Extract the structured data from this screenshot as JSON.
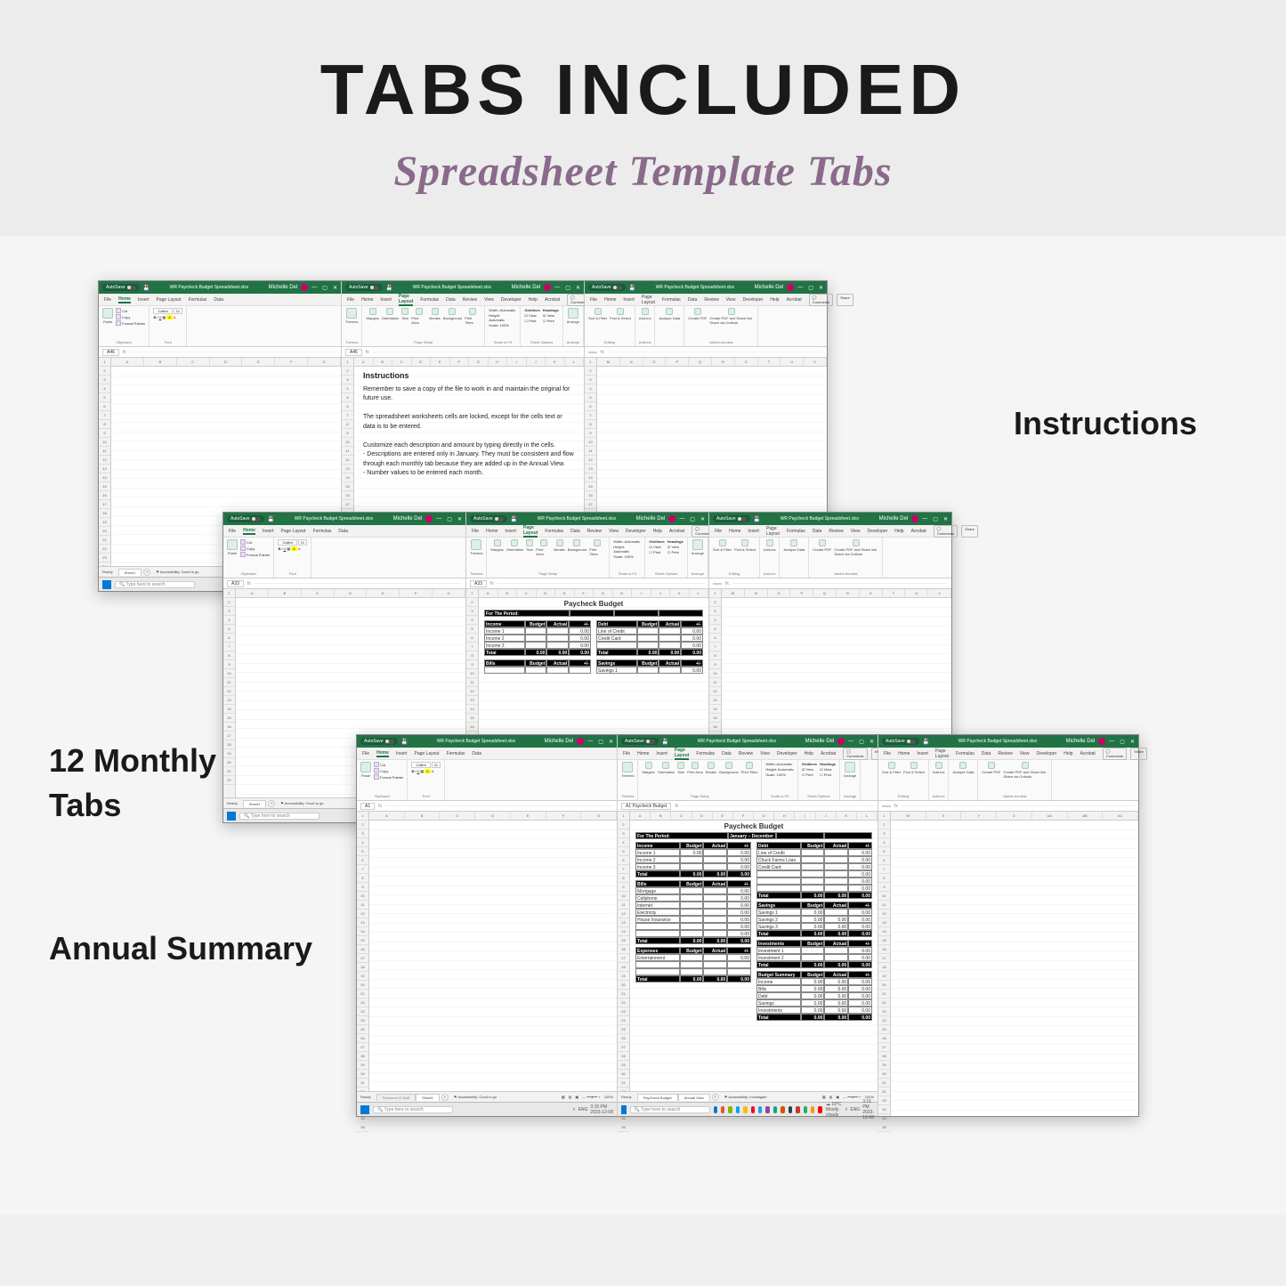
{
  "title": "TABS INCLUDED",
  "subtitle": "Spreadsheet Template Tabs",
  "labels": {
    "instructions": "Instructions",
    "monthly": "12 Monthly Tabs",
    "annual": "Annual Summary"
  },
  "excel": {
    "autosave": "AutoSave",
    "filename": "WR Paycheck Budget Spreadsheet.xlsx",
    "user": "Michelle Del",
    "ribbon_tabs": [
      "File",
      "Home",
      "Insert",
      "Page Layout",
      "Formulas",
      "Data",
      "Review",
      "View",
      "Developer",
      "Help",
      "Acrobat"
    ],
    "ribbon_tabs_simple": [
      "File",
      "Home",
      "Insert",
      "Page Layout",
      "Formulas",
      "Data"
    ],
    "comments": "Comments",
    "share": "Share",
    "ribbon_home": {
      "paste": "Paste",
      "cut": "Cut",
      "copy": "Copy",
      "format_painter": "Format Painter",
      "clipboard": "Clipboard",
      "font_name": "Calibri",
      "font_size": "11",
      "font": "Font"
    },
    "ribbon_pagelayout": {
      "themes": "Themes",
      "margins": "Margins",
      "orientation": "Orientation",
      "size": "Size",
      "print_area": "Print Area",
      "breaks": "Breaks",
      "background": "Background",
      "print_titles": "Print Titles",
      "page_setup": "Page Setup",
      "width": "Width:",
      "height": "Height:",
      "scale": "Scale:",
      "automatic": "Automatic",
      "hundred": "100%",
      "scale_to_fit": "Scale to Fit",
      "gridlines": "Gridlines",
      "headings": "Headings",
      "view": "View",
      "print": "Print",
      "sheet_options": "Sheet Options",
      "arrange": "Arrange"
    },
    "ribbon_right": {
      "sort_filter": "Sort & Filter",
      "find_select": "Find & Select",
      "editing": "Editing",
      "addins": "Add-ins",
      "analyze": "Analyze Data",
      "create_pdf": "Create PDF",
      "create_share": "Create PDF and Share link Share via Outlook",
      "adobe": "Adobe Acrobat"
    },
    "cols": [
      "A",
      "B",
      "C",
      "D",
      "E",
      "F",
      "G",
      "H",
      "I",
      "J",
      "K",
      "L",
      "M",
      "N",
      "O",
      "P",
      "Q",
      "R",
      "S",
      "T",
      "U",
      "V",
      "W",
      "X",
      "Y",
      "Z",
      "AA",
      "AB",
      "AC"
    ],
    "namebox1": "A46",
    "namebox2": "A33",
    "namebox3": "A1",
    "fx": "fx",
    "ready": "Ready",
    "accessibility_ok": "Accessibility: Good to go",
    "accessibility_inv": "Accessibility: Investigate",
    "sheet1": "Sheet1",
    "tab_paycheck": "PayCheck Budget",
    "tab_annual": "Annual View",
    "tab_dim": "Password & Stuff",
    "search_placeholder": "Type here to search",
    "weather": "19°C  Mostly cloudy",
    "lang": "ENG",
    "time": "3:15 PM",
    "date": "2023-12-08"
  },
  "instructions_doc": {
    "heading": "Instructions",
    "l1": "Remember to save a copy of the file to work in and maintain the original for future use.",
    "l2": "The spreadsheet worksheets cells are locked, except for the cells text or data is to be entered.",
    "l3a": "Customize each description and amount by typing directly in the cells.",
    "l3b": "- Descriptions are entered only in January. They must be consistent and flow",
    "l3c": "  through each monthly tab because they are added up in the Annual View.",
    "l3d": "- Number values to be entered each month."
  },
  "budget": {
    "title": "Paycheck Budget",
    "period_label": "For The Period:",
    "period_value": "January – December",
    "income": {
      "header": [
        "Income",
        "Budget",
        "Actual",
        "+/-"
      ],
      "rows": [
        [
          "Income 1",
          "0.00",
          "",
          "0.00"
        ],
        [
          "Income 2",
          "",
          "",
          "0.00"
        ],
        [
          "Income 3",
          "",
          "",
          "0.00"
        ]
      ],
      "total": [
        "Total",
        "0.00",
        "0.00",
        "0.00"
      ]
    },
    "bills": {
      "header": [
        "Bills",
        "Budget",
        "Actual",
        "+/-"
      ],
      "rows": [
        [
          "Mortgage",
          "",
          "",
          "0.00"
        ],
        [
          "Cellphone",
          "",
          "",
          "0.00"
        ],
        [
          "Internet",
          "",
          "",
          "0.00"
        ],
        [
          "Electricity",
          "",
          "",
          "0.00"
        ],
        [
          "House Insurance",
          "",
          "",
          "0.00"
        ],
        [
          "",
          "",
          "",
          "0.00"
        ],
        [
          "",
          "",
          "",
          "0.00"
        ]
      ],
      "total": [
        "Total",
        "0.00",
        "0.00",
        "0.00"
      ]
    },
    "expenses": {
      "header": [
        "Expenses",
        "Budget",
        "Actual",
        "+/-"
      ],
      "rows": [
        [
          "Entertainment",
          "",
          "",
          "0.00"
        ],
        [
          "",
          "",
          "",
          ""
        ],
        [
          "",
          "",
          "",
          ""
        ]
      ],
      "total": [
        "Total",
        "0.00",
        "0.00",
        "0.00"
      ]
    },
    "debt": {
      "header": [
        "Debt",
        "Budget",
        "Actual",
        "+/-"
      ],
      "rows": [
        [
          "Line of Credit",
          "",
          "",
          "0.00"
        ],
        [
          "Chuck Farms Loan",
          "",
          "",
          "0.00"
        ],
        [
          "Credit Card",
          "",
          "",
          "0.00"
        ],
        [
          "",
          "",
          "",
          "0.00"
        ],
        [
          "",
          "",
          "",
          "0.00"
        ],
        [
          "",
          "",
          "",
          "0.00"
        ]
      ],
      "total": [
        "Total",
        "0.00",
        "0.00",
        "0.00"
      ]
    },
    "savings": {
      "header": [
        "Savings",
        "Budget",
        "Actual",
        "+/-"
      ],
      "rows": [
        [
          "Savings 1",
          "0.00",
          "",
          "0.00"
        ],
        [
          "Savings 2",
          "0.00",
          "0.00",
          "0.00"
        ],
        [
          "Savings 3",
          "0.00",
          "0.00",
          "0.00"
        ]
      ],
      "total": [
        "Total",
        "0.00",
        "0.00",
        "0.00"
      ]
    },
    "invest": {
      "header": [
        "Investments",
        "Budget",
        "Actual",
        "+/-"
      ],
      "rows": [
        [
          "Investment 1",
          "",
          "",
          "0.00"
        ],
        [
          "Investment 2",
          "",
          "",
          "0.00"
        ]
      ],
      "total": [
        "Total",
        "0.00",
        "0.00",
        "0.00"
      ]
    },
    "summary": {
      "header": [
        "Budget Summary",
        "Budget",
        "Actual",
        "+/-"
      ],
      "rows": [
        [
          "Income",
          "0.00",
          "0.00",
          "0.00"
        ],
        [
          "Bills",
          "0.00",
          "0.00",
          "0.00"
        ],
        [
          "Debt",
          "0.00",
          "0.00",
          "0.00"
        ],
        [
          "Savings",
          "0.00",
          "0.00",
          "0.00"
        ],
        [
          "Investments",
          "0.00",
          "0.00",
          "0.00"
        ]
      ],
      "total": [
        "Total",
        "0.00",
        "0.00",
        "0.00"
      ]
    },
    "short1": {
      "header": [
        "Income",
        "Budget",
        "Actual",
        "+/-"
      ],
      "rows": [
        [
          "Income 1",
          "",
          "",
          "0.00"
        ],
        [
          "Income 2",
          "",
          "",
          "0.00"
        ],
        [
          "Income 3",
          "",
          "",
          "0.00"
        ]
      ],
      "total": [
        "Total",
        "0.00",
        "0.00",
        "0.00"
      ]
    },
    "short2": {
      "header": [
        "Bills",
        "Budget",
        "Actual",
        "+/-"
      ],
      "rows": [
        [
          "",
          "",
          "",
          ""
        ]
      ]
    },
    "short3": {
      "header": [
        "Debt",
        "Budget",
        "Actual",
        "+/-"
      ],
      "rows": [
        [
          "Line of Credit",
          "",
          "",
          "0.00"
        ],
        [
          "Credit Card",
          "",
          "",
          "0.00"
        ],
        [
          "",
          "",
          "",
          "0.00"
        ]
      ],
      "total": [
        "Total",
        "0.00",
        "0.00",
        "0.00"
      ]
    },
    "short4": {
      "header": [
        "Savings",
        "Budget",
        "Actual",
        "+/-"
      ],
      "rows": [
        [
          "Savings 1",
          "",
          "",
          "0.00"
        ]
      ]
    }
  }
}
